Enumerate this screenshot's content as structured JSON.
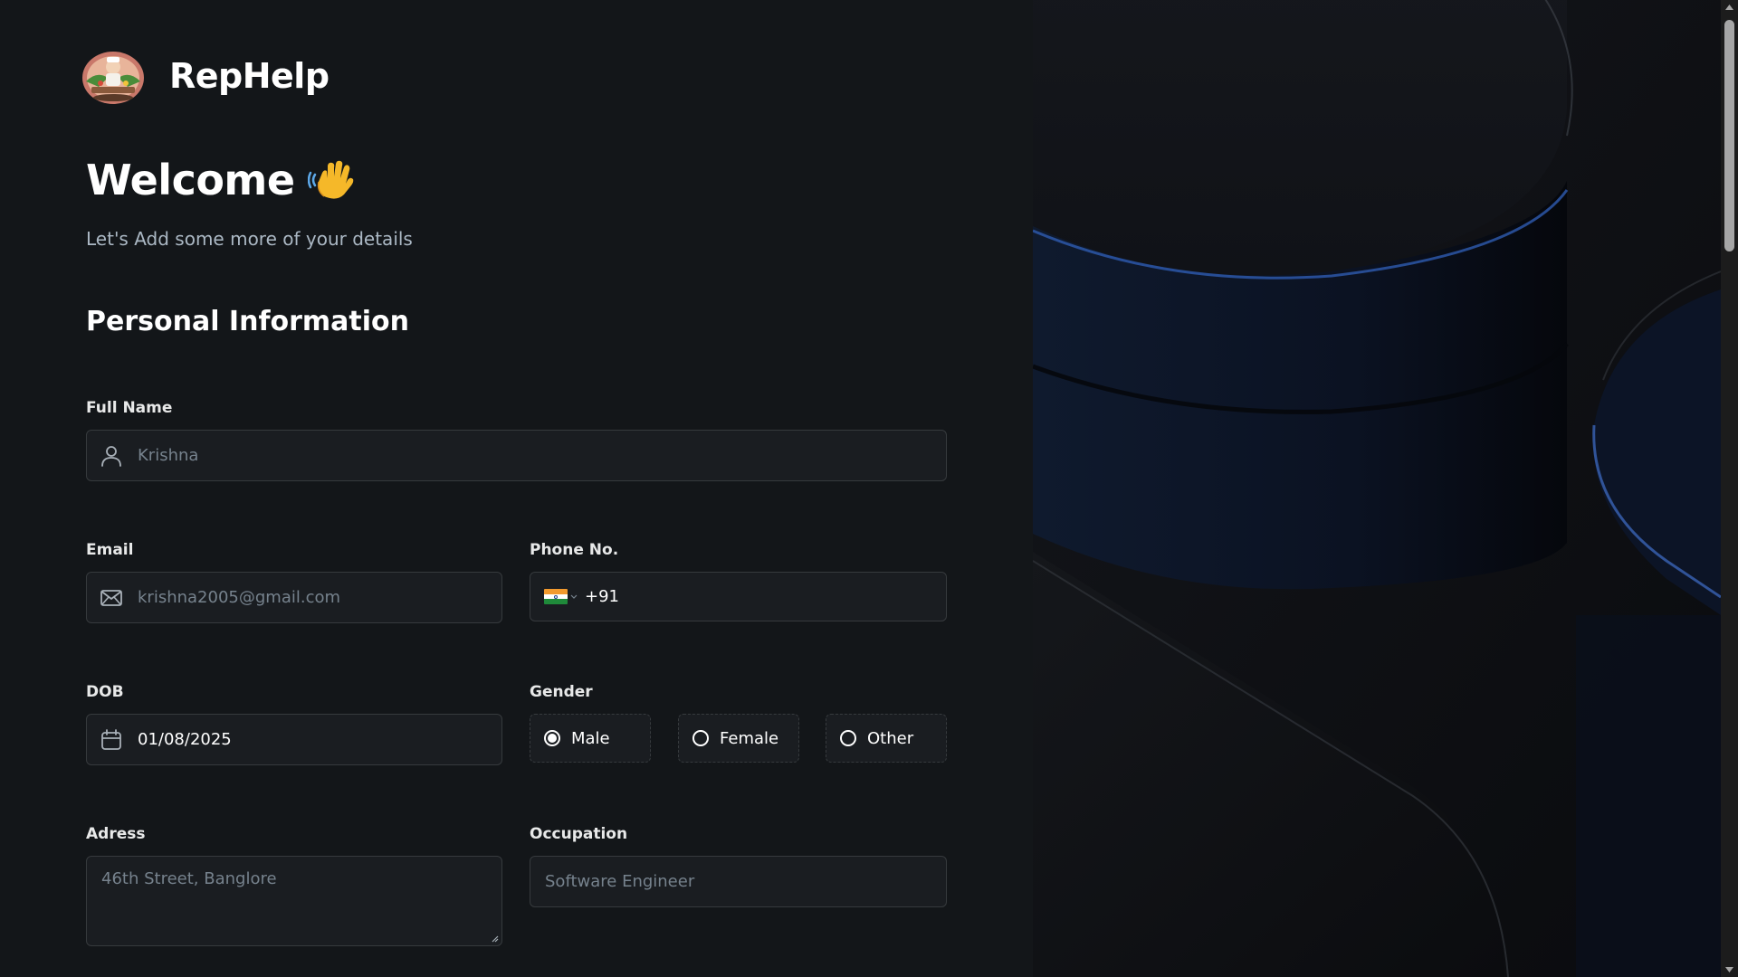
{
  "app": {
    "name": "RepHelp",
    "logo_icon": "chef-character-logo"
  },
  "header": {
    "welcome": "Welcome",
    "wave_icon": "waving-hand-icon",
    "subtitle": "Let's Add some more of your details"
  },
  "form": {
    "section_title": "Personal Information",
    "full_name": {
      "label": "Full Name",
      "placeholder": "Krishna",
      "icon": "user-icon"
    },
    "email": {
      "label": "Email",
      "placeholder": "krishna2005@gmail.com",
      "icon": "mail-icon"
    },
    "phone": {
      "label": "Phone No.",
      "country_flag": "india-flag",
      "value": "+91"
    },
    "dob": {
      "label": "DOB",
      "value": "01/08/2025",
      "icon": "calendar-icon"
    },
    "gender": {
      "label": "Gender",
      "options": [
        "Male",
        "Female",
        "Other"
      ],
      "selected": "Male"
    },
    "address": {
      "label": "Adress",
      "placeholder": "46th Street, Banglore"
    },
    "occupation": {
      "label": "Occupation",
      "placeholder": "Software Engineer"
    }
  },
  "colors": {
    "background": "#131619",
    "field_bg": "#1a1d21",
    "field_border": "#363a3d",
    "text_primary": "#ffffff",
    "text_muted": "#76828d",
    "subtitle": "#abb8c4"
  }
}
